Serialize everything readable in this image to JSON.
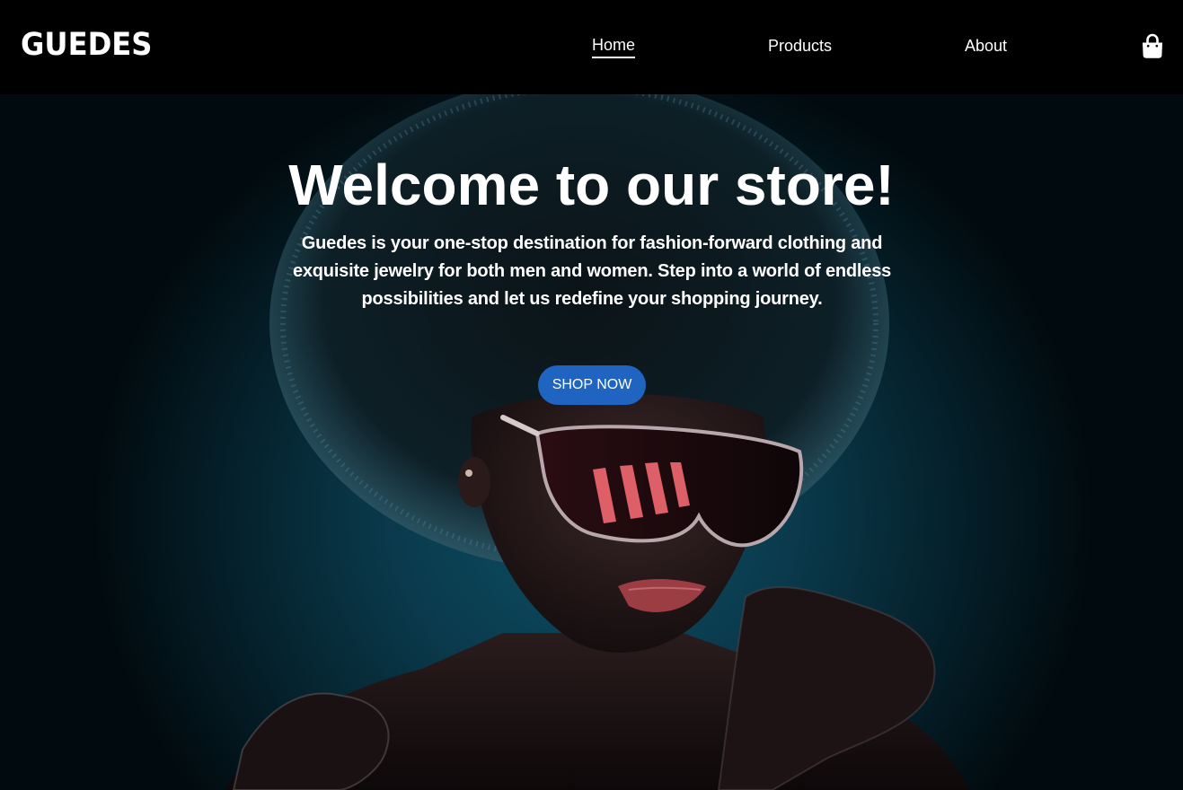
{
  "brand": {
    "name": "GUEDES"
  },
  "nav": {
    "items": [
      {
        "label": "Home",
        "active": true
      },
      {
        "label": "Products",
        "active": false
      },
      {
        "label": "About",
        "active": false
      }
    ],
    "cart_icon": "shopping-bag-icon"
  },
  "hero": {
    "title": "Welcome to our store!",
    "description": "Guedes is your one-stop destination for fashion-forward clothing and exquisite jewelry for both men and women. Step into a world of endless possibilities and let us redefine your shopping journey.",
    "button_label": "SHOP NOW",
    "image_subject": "woman-with-sunglasses-photo"
  },
  "colors": {
    "nav_background": "#000000",
    "accent_button": "#1e64c0",
    "hero_background": "#0a3a4c",
    "text": "#ffffff"
  }
}
